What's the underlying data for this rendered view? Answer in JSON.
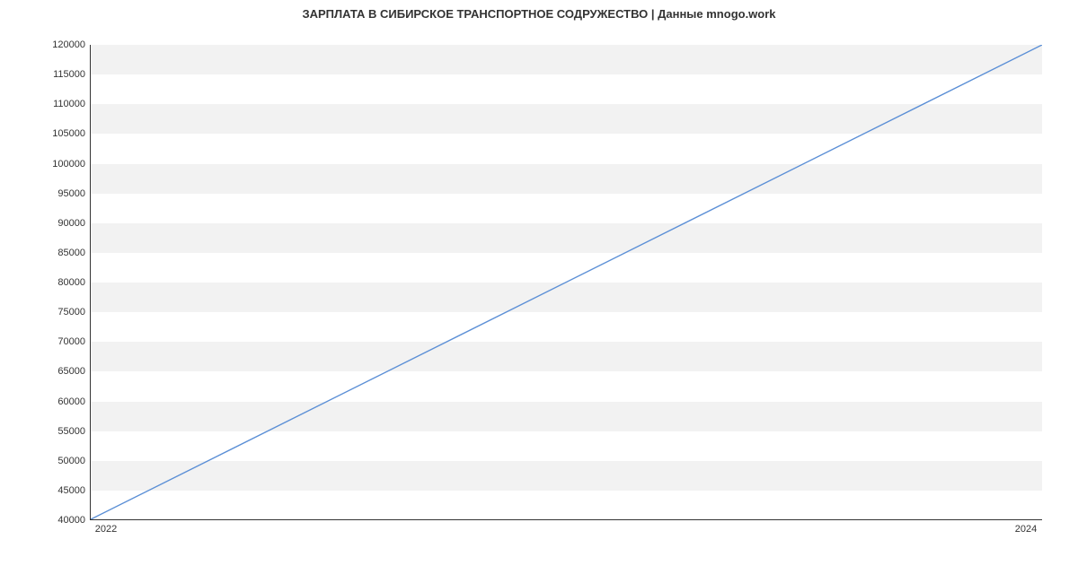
{
  "chart_data": {
    "type": "line",
    "title": "ЗАРПЛАТА В  СИБИРСКОЕ ТРАНСПОРТНОЕ СОДРУЖЕСТВО | Данные mnogo.work",
    "xlabel": "",
    "ylabel": "",
    "x": [
      2022,
      2024
    ],
    "values": [
      40000,
      120000
    ],
    "xlim": [
      2022,
      2024
    ],
    "ylim": [
      40000,
      120000
    ],
    "yticks": [
      40000,
      45000,
      50000,
      55000,
      60000,
      65000,
      70000,
      75000,
      80000,
      85000,
      90000,
      95000,
      100000,
      105000,
      110000,
      115000,
      120000
    ],
    "xticks": [
      2022,
      2024
    ],
    "line_color": "#5b8fd6",
    "band_color": "#f2f2f2",
    "grid": true
  }
}
